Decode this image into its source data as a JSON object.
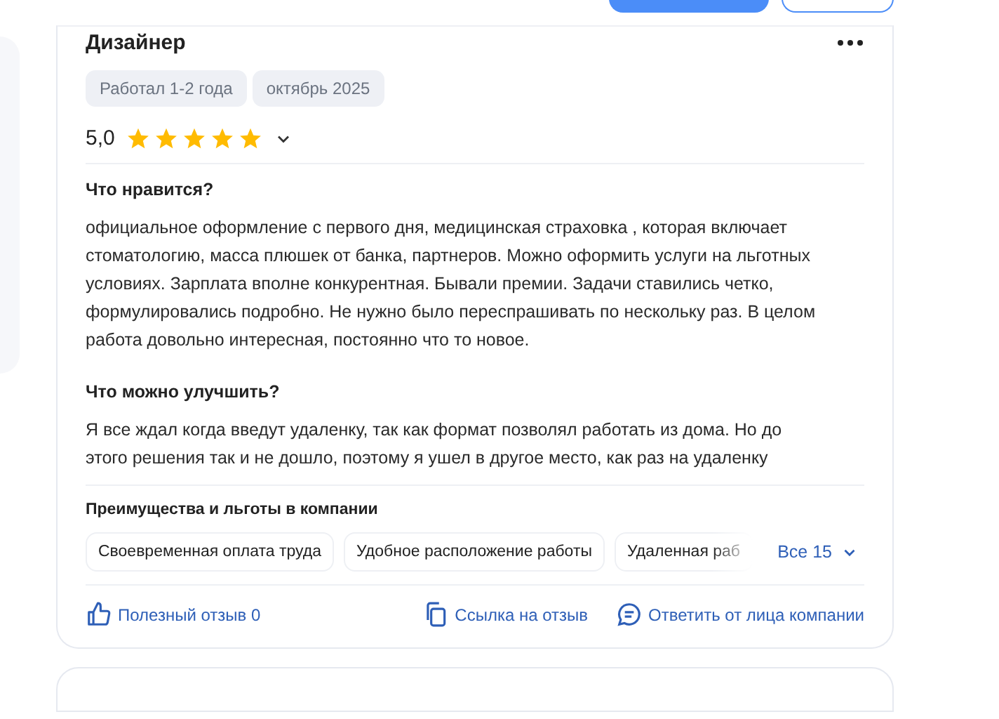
{
  "review": {
    "position": "Дизайнер",
    "tags": [
      "Работал 1-2 года",
      "октябрь 2025"
    ],
    "rating": "5,0",
    "stars": 5,
    "sections": [
      {
        "title": "Что нравится?",
        "text": "официальное оформление с первого дня, медицинская страховка , которая включает стоматологию, масса плюшек от банка, партнеров. Можно оформить услуги на льготных условиях. Зарплата вполне конкурентная. Бывали премии. Задачи ставились четко, формулировались подробно. Не нужно было переспрашивать по нескольку раз. В целом работа довольно интересная, постоянно что то новое."
      },
      {
        "title": "Что можно улучшить?",
        "text": "Я все ждал когда введут удаленку, так как формат позволял работать из дома. Но до этого решения так и не дошло, поэтому я ушел в другое место, как раз на удаленку"
      }
    ],
    "benefits": {
      "title": "Преимущества и льготы в компании",
      "items": [
        "Своевременная оплата труда",
        "Удобное расположение работы",
        "Удаленная раб"
      ],
      "more": "Все 15"
    },
    "actions": [
      {
        "kind": "like",
        "label": "Полезный отзыв 0"
      },
      {
        "kind": "copy",
        "label": "Ссылка на отзыв"
      },
      {
        "kind": "reply",
        "label": "Ответить от лица компании"
      }
    ]
  }
}
